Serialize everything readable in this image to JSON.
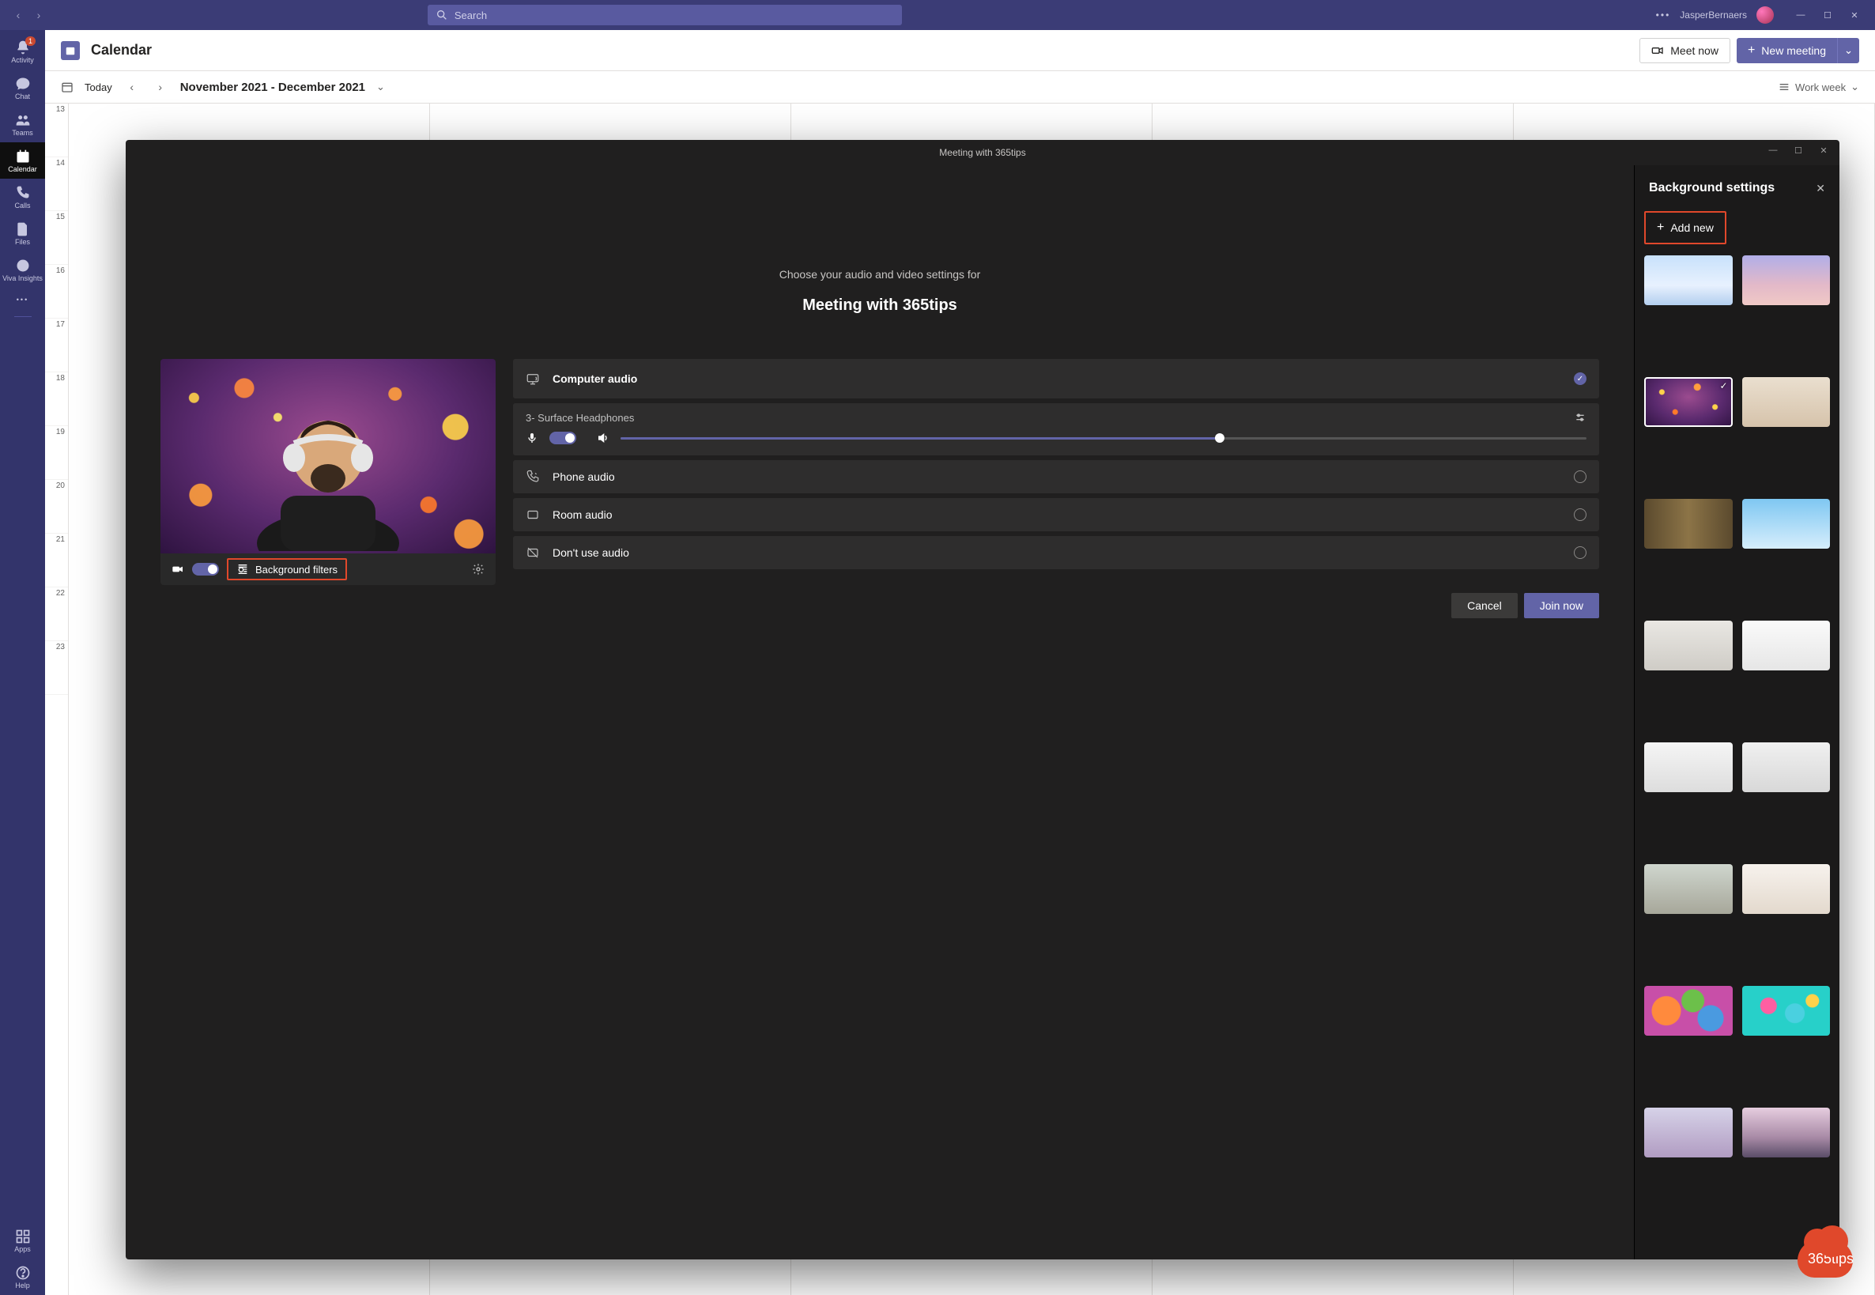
{
  "titlebar": {
    "search_placeholder": "Search",
    "username": "JasperBernaers"
  },
  "rail": {
    "items": [
      {
        "key": "activity",
        "label": "Activity",
        "badge": "1"
      },
      {
        "key": "chat",
        "label": "Chat"
      },
      {
        "key": "teams",
        "label": "Teams"
      },
      {
        "key": "calendar",
        "label": "Calendar",
        "selected": true
      },
      {
        "key": "calls",
        "label": "Calls"
      },
      {
        "key": "files",
        "label": "Files"
      },
      {
        "key": "insights",
        "label": "Viva Insights"
      }
    ],
    "apps_label": "Apps",
    "help_label": "Help"
  },
  "calendar": {
    "title": "Calendar",
    "meet_now": "Meet now",
    "new_meeting": "New meeting",
    "today": "Today",
    "range": "November 2021 - December 2021",
    "view": "Work week",
    "hours": [
      "13",
      "14",
      "15",
      "16",
      "17",
      "18",
      "19",
      "20",
      "21",
      "22",
      "23"
    ]
  },
  "modal": {
    "window_title": "Meeting with 365tips",
    "prompt": "Choose your audio and video settings for",
    "meeting_title": "Meeting with 365tips",
    "bg_filters": "Background filters",
    "audio": {
      "computer": "Computer audio",
      "device": "3- Surface Headphones",
      "phone": "Phone audio",
      "room": "Room audio",
      "none": "Don't use audio"
    },
    "cancel": "Cancel",
    "join": "Join now"
  },
  "panel": {
    "title": "Background settings",
    "add_new": "Add new",
    "thumbs": [
      "t-winter",
      "t-sky",
      "t-confetti",
      "t-bedroom",
      "t-library",
      "t-pool",
      "t-modern",
      "t-white1",
      "t-white2",
      "t-white3",
      "t-office",
      "t-studio",
      "t-balloons",
      "t-bubbles",
      "t-bridge",
      "t-mountain"
    ],
    "selected_index": 2
  },
  "watermark": "365tips"
}
